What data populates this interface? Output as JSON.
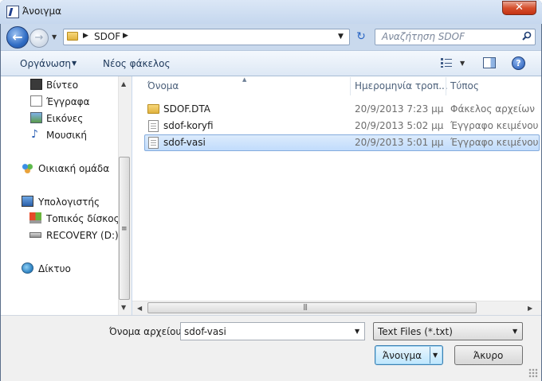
{
  "window": {
    "title": "Άνοιγμα",
    "close_glyph": "✕"
  },
  "address": {
    "path": [
      "SDOF"
    ],
    "search_placeholder": "Αναζήτηση SDOF"
  },
  "toolbar": {
    "organize": "Οργάνωση",
    "new_folder": "Νέος φάκελος"
  },
  "nav": {
    "items": [
      {
        "label": "Βίντεο",
        "icon": "video-library-icon"
      },
      {
        "label": "Έγγραφα",
        "icon": "documents-library-icon"
      },
      {
        "label": "Εικόνες",
        "icon": "pictures-library-icon"
      },
      {
        "label": "Μουσική",
        "icon": "music-library-icon"
      },
      {
        "label": "Οικιακή ομάδα",
        "icon": "homegroup-icon"
      },
      {
        "label": "Υπολογιστής",
        "icon": "computer-icon"
      },
      {
        "label": "Τοπικός δίσκος (",
        "icon": "local-disk-icon"
      },
      {
        "label": "RECOVERY (D:)",
        "icon": "drive-icon"
      },
      {
        "label": "Δίκτυο",
        "icon": "network-icon"
      }
    ]
  },
  "files": {
    "columns": {
      "name": "Όνομα",
      "date": "Ημερομηνία τροπ...",
      "type": "Τύπος"
    },
    "rows": [
      {
        "name": "SDOF.DTA",
        "date": "20/9/2013 7:23 μμ",
        "type": "Φάκελος αρχείων",
        "icon": "folder-icon",
        "selected": false
      },
      {
        "name": "sdof-koryfi",
        "date": "20/9/2013 5:02 μμ",
        "type": "Έγγραφο κειμένου",
        "icon": "text-file-icon",
        "selected": false
      },
      {
        "name": "sdof-vasi",
        "date": "20/9/2013 5:01 μμ",
        "type": "Έγγραφο κειμένου",
        "icon": "text-file-icon",
        "selected": true
      }
    ]
  },
  "bottom": {
    "filename_label": "Όνομα αρχείου:",
    "filename_value": "sdof-vasi",
    "filter_value": "Text Files (*.txt)",
    "open_label": "Άνοιγμα",
    "cancel_label": "Άκυρο"
  },
  "colors": {
    "accent": "#3c7fb1",
    "selection": "#c1dcfc",
    "close": "#d6502e"
  }
}
